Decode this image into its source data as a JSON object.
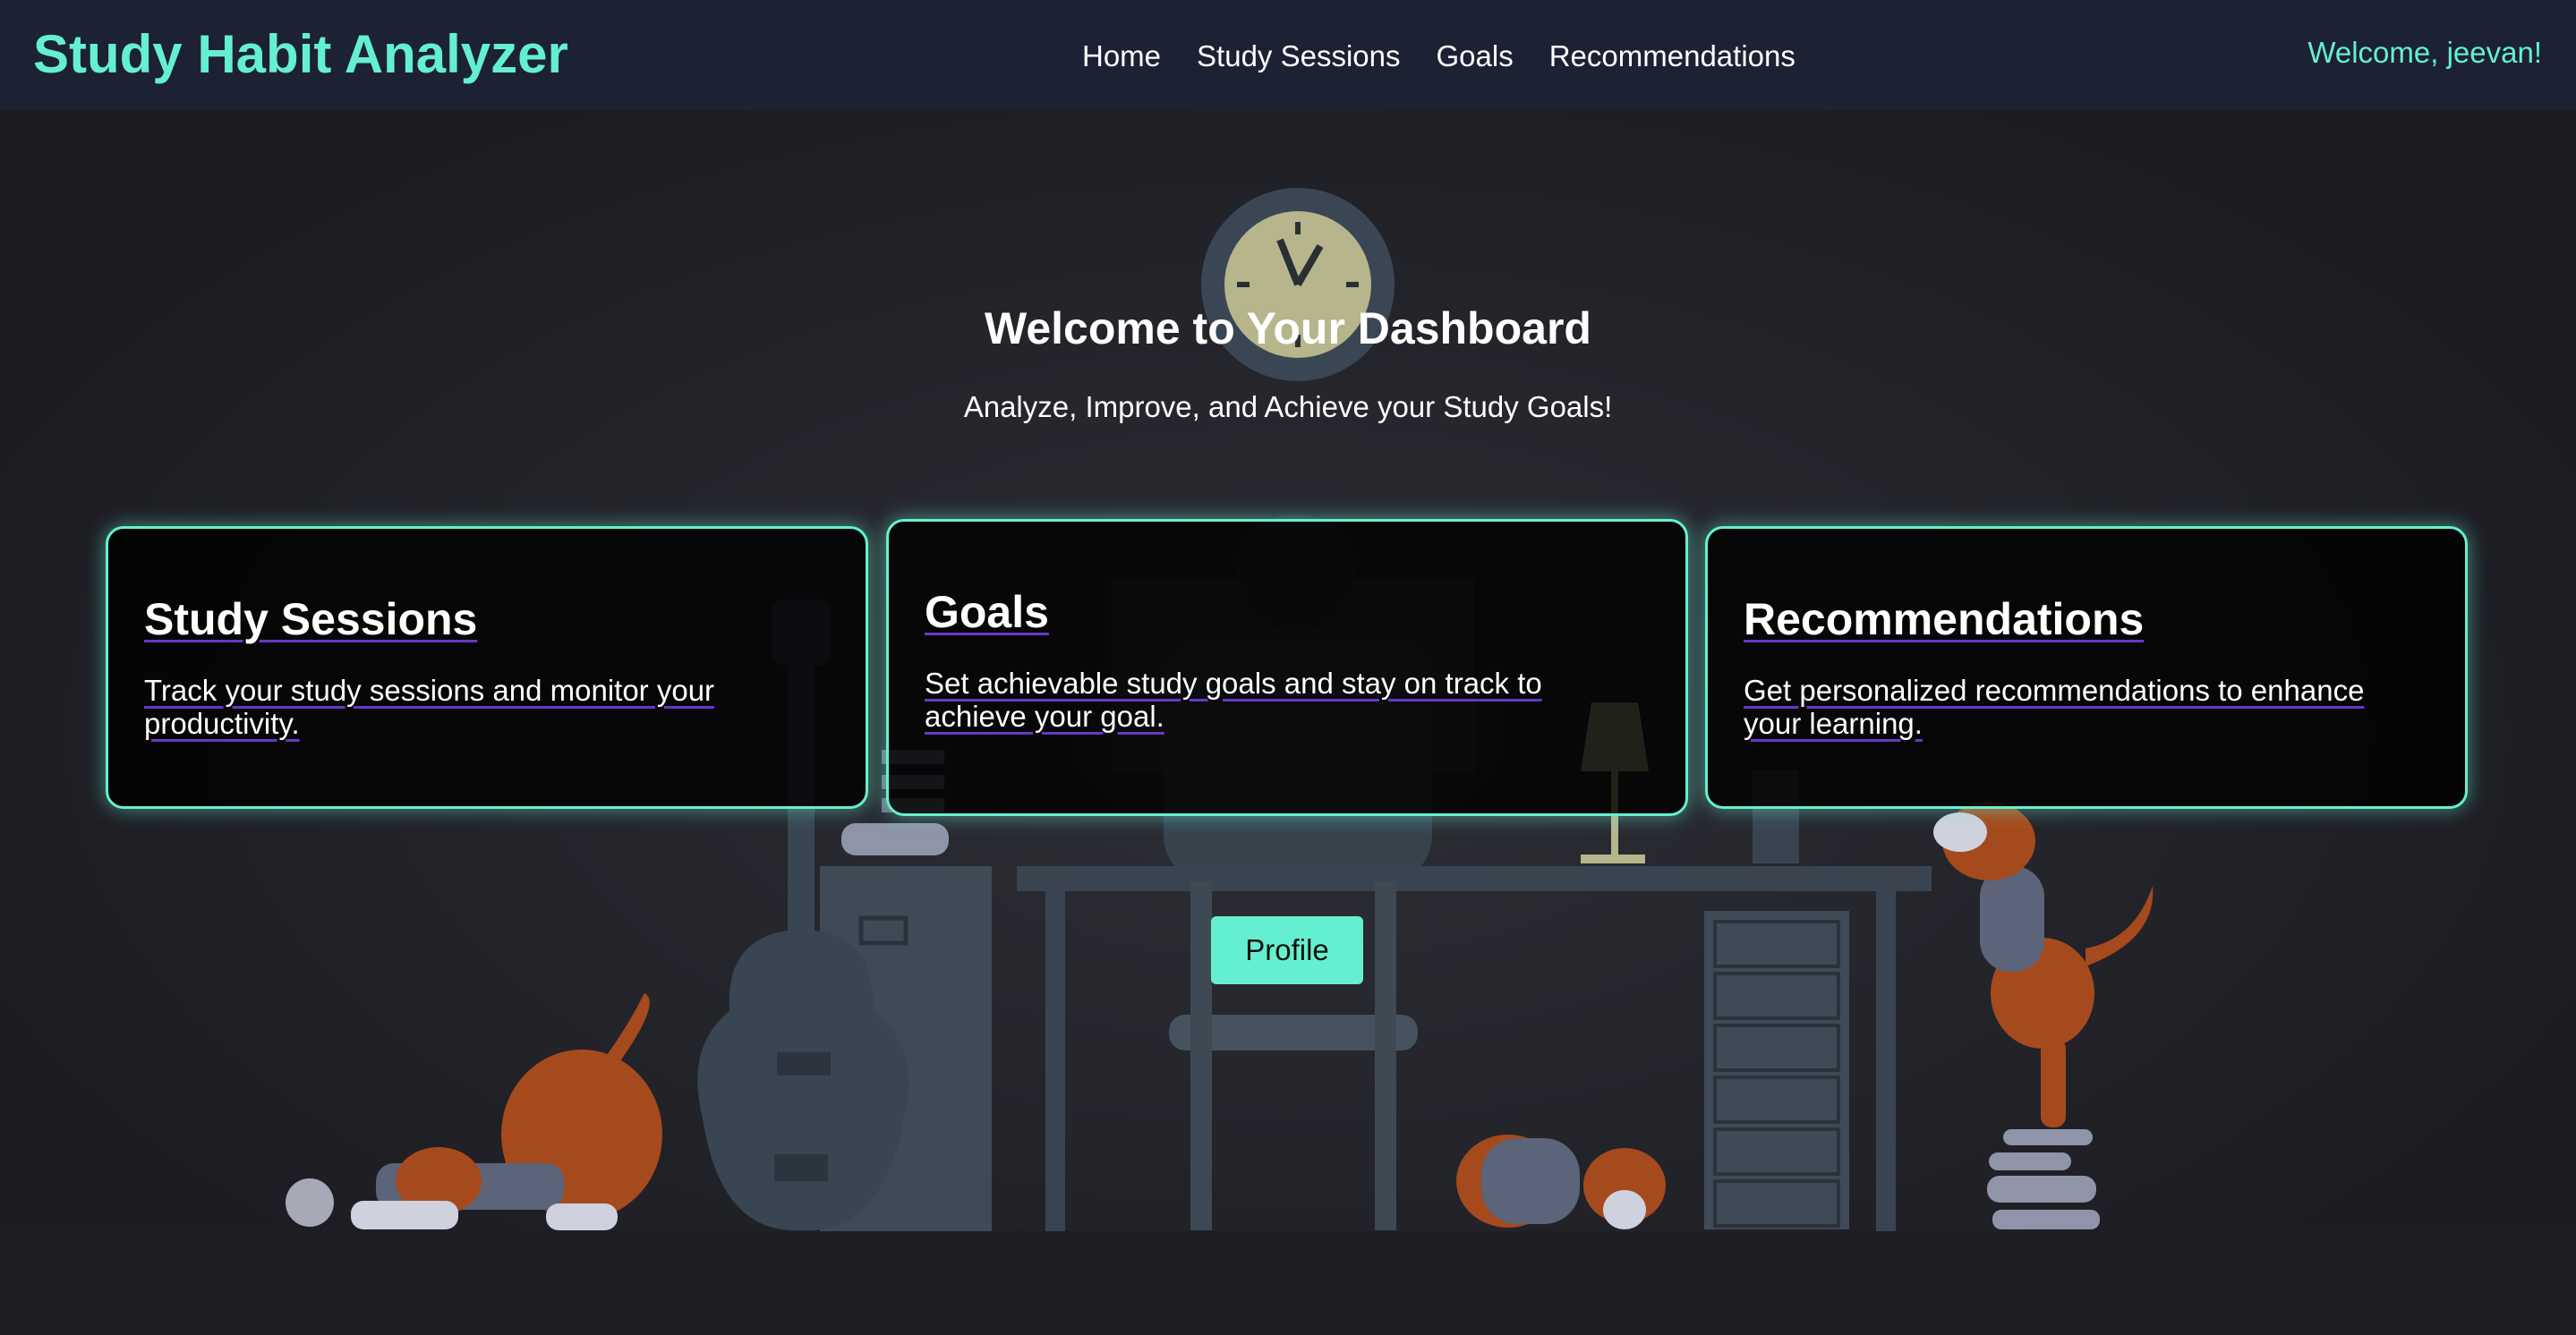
{
  "header": {
    "brand": "Study Habit Analyzer",
    "nav": [
      "Home",
      "Study Sessions",
      "Goals",
      "Recommendations"
    ],
    "welcome": "Welcome, jeevan!"
  },
  "hero": {
    "title": "Welcome to Your Dashboard",
    "subtitle": "Analyze, Improve, and Achieve your Study Goals!"
  },
  "cards": [
    {
      "title": "Study Sessions",
      "description": "Track your study sessions and monitor your productivity."
    },
    {
      "title": "Goals",
      "description": "Set achievable study goals and stay on track to achieve your goal."
    },
    {
      "title": "Recommendations",
      "description": "Get personalized recommendations to enhance your learning."
    }
  ],
  "profile_button": "Profile",
  "colors": {
    "accent": "#64f0d0",
    "navbar": "#1d2134",
    "background": "#1c1c22",
    "underline": "#6b35c9"
  },
  "icons": [
    "clock-icon",
    "guitar-icon",
    "desk-lamp-icon",
    "dog-icon",
    "book-stack-icon"
  ]
}
